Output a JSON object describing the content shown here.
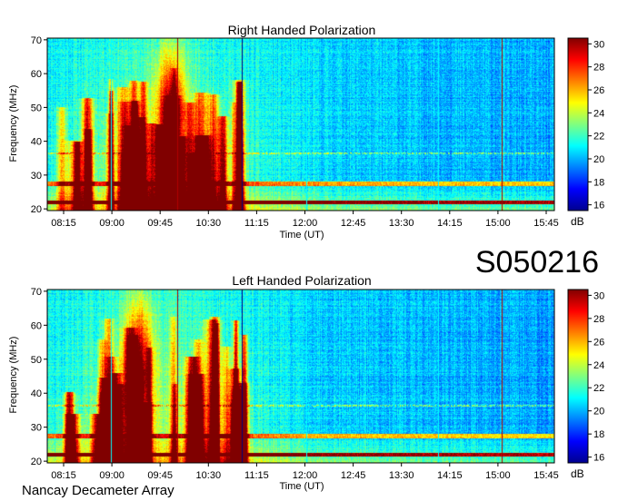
{
  "figure": {
    "code": "S050216",
    "footer": "Nancay Decameter Array"
  },
  "chart_data": [
    {
      "type": "heatmap",
      "title": "Right Handed Polarization",
      "xlabel": "Time (UT)",
      "ylabel": "Frequency (MHz)",
      "x_ticks": [
        "08:15",
        "09:00",
        "09:45",
        "10:30",
        "11:15",
        "12:00",
        "12:45",
        "13:30",
        "14:15",
        "15:00",
        "15:45"
      ],
      "y_ticks": [
        20,
        30,
        40,
        50,
        60,
        70
      ],
      "ylim": [
        19.5,
        70.5
      ],
      "colorbar": {
        "ticks": [
          16,
          18,
          20,
          22,
          24,
          26,
          28,
          30
        ],
        "range": [
          15.5,
          30.5
        ],
        "unit": "dB"
      }
    },
    {
      "type": "heatmap",
      "title": "Left Handed Polarization",
      "xlabel": "Time (UT)",
      "ylabel": "Frequency (MHz)",
      "x_ticks": [
        "08:15",
        "09:00",
        "09:45",
        "10:30",
        "11:15",
        "12:00",
        "12:45",
        "13:30",
        "14:15",
        "15:00",
        "15:45"
      ],
      "y_ticks": [
        20,
        30,
        40,
        50,
        60,
        70
      ],
      "ylim": [
        19.5,
        70.5
      ],
      "colorbar": {
        "ticks": [
          16,
          18,
          20,
          22,
          24,
          26,
          28,
          30
        ],
        "range": [
          15.5,
          30.5
        ],
        "unit": "dB"
      }
    }
  ]
}
